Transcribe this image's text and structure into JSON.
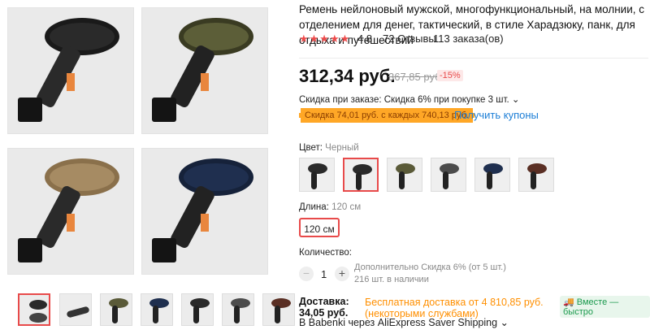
{
  "product": {
    "title": "Ремень нейлоновый мужской, многофункциональный, на молнии, с отделением для денег, тактический, в стиле Харадзюку, панк, для отдыха и путешествий",
    "rating": "4.8",
    "stars": "★★★★★",
    "reviews": "72 Отзывы",
    "orders": "113 заказа(ов)"
  },
  "price": {
    "current": "312,34 руб.",
    "old": "367,85 руб.",
    "discount": "-15%",
    "order_discount": "Скидка при заказе: Скидка 6% при покупке 3 шт. ⌄",
    "coupon": "Скидка 74,01 руб. с каждых 740,13 руб.",
    "coupon_link": "Получить купоны"
  },
  "color": {
    "label": "Цвет:",
    "value": "Черный"
  },
  "colors": [
    "#2a2a2a",
    "#5a5a38",
    "#2e2e2e",
    "#4c4c4c",
    "#1f2f4f",
    "#5a2f24"
  ],
  "photo_colors": [
    "#2a2a2a",
    "#5c5e38",
    "#a68b63",
    "#1f2f4f"
  ],
  "thumb_colors": [
    "#2a2a2a",
    "#444",
    "#5a5a38",
    "#1f2f4f",
    "#2a2a2a",
    "#4c4c4c",
    "#5a2f24"
  ],
  "length": {
    "label": "Длина:",
    "value": "120 см",
    "option": "120 см"
  },
  "quantity": {
    "label": "Количество:",
    "minus": "−",
    "value": "1",
    "plus": "+",
    "note_1": "Дополнительно Скидка 6% (от 5 шт.)",
    "note_2": "216 шт. в наличии"
  },
  "shipping": {
    "label_1": "Доставка:",
    "label_2": "34,05 руб.",
    "free_1": "Бесплатная доставка от 4 810,85 руб.",
    "free_2": "(некоторыми службами)",
    "badge": "Вместе — быстро",
    "via": "В Babenki через AliExpress Saver Shipping ⌄"
  }
}
